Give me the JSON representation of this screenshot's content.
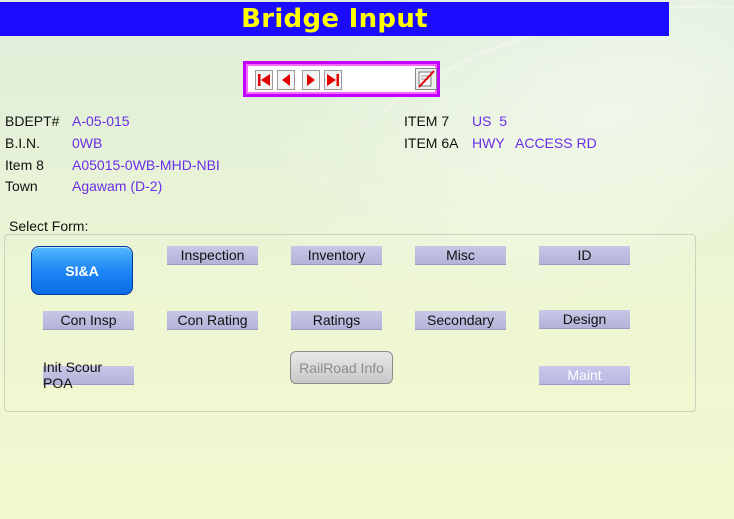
{
  "title": "Bridge Input",
  "nav": {
    "first": "first-record",
    "prev": "previous-record",
    "next": "next-record",
    "last": "last-record",
    "edit": "edit-icon"
  },
  "fields": {
    "bdept_label": "BDEPT#",
    "bdept_value": "A-05-015",
    "bin_label": "B.I.N.",
    "bin_value": "0WB",
    "item8_label": "Item 8",
    "item8_value": "A05015-0WB-MHD-NBI",
    "town_label": "Town",
    "town_value": "Agawam (D-2)",
    "item7_label": "ITEM 7",
    "item7_value": "US  5",
    "item6a_label": "ITEM 6A",
    "item6a_value1": "HWY",
    "item6a_value2": "ACCESS RD"
  },
  "select_form_label": "Select Form:",
  "forms": {
    "sia": "SI&A",
    "inspection": "Inspection",
    "inventory": "Inventory",
    "misc": "Misc",
    "id": "ID",
    "con_insp": "Con Insp",
    "con_rating": "Con Rating",
    "ratings": "Ratings",
    "secondary": "Secondary",
    "design": "Design",
    "init_scour": "Init Scour POA",
    "railroad": "RailRoad Info",
    "maint": "Maint"
  },
  "colors": {
    "title_bg": "#1b0bff",
    "title_text": "#ffff00",
    "value_text": "#6b2ee8",
    "nav_border": "#c000ff"
  }
}
